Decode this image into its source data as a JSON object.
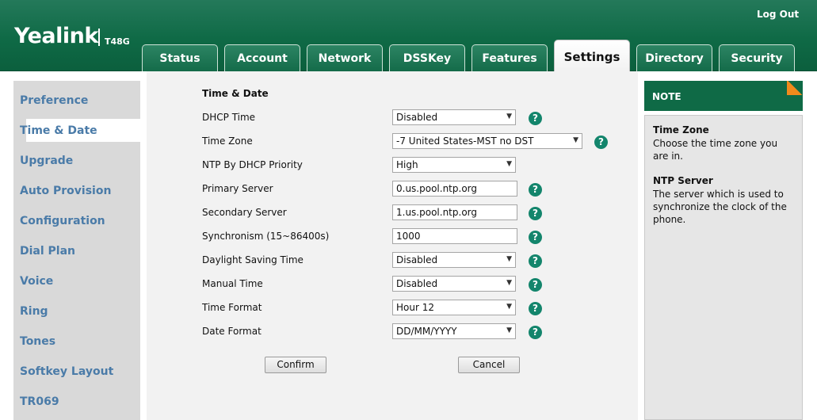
{
  "header": {
    "brand": "Yealink",
    "model": "T48G",
    "logout": "Log Out",
    "tabs": [
      {
        "label": "Status"
      },
      {
        "label": "Account"
      },
      {
        "label": "Network"
      },
      {
        "label": "DSSKey"
      },
      {
        "label": "Features"
      },
      {
        "label": "Settings",
        "active": true
      },
      {
        "label": "Directory"
      },
      {
        "label": "Security"
      }
    ]
  },
  "sidebar": {
    "items": [
      {
        "label": "Preference"
      },
      {
        "label": "Time & Date",
        "active": true
      },
      {
        "label": "Upgrade"
      },
      {
        "label": "Auto Provision"
      },
      {
        "label": "Configuration"
      },
      {
        "label": "Dial Plan"
      },
      {
        "label": "Voice"
      },
      {
        "label": "Ring"
      },
      {
        "label": "Tones"
      },
      {
        "label": "Softkey Layout"
      },
      {
        "label": "TR069"
      }
    ]
  },
  "form": {
    "title": "Time & Date",
    "rows": [
      {
        "label": "DHCP Time",
        "type": "select",
        "value": "Disabled"
      },
      {
        "label": "Time Zone",
        "type": "select",
        "value": "-7 United States-MST no DST"
      },
      {
        "label": "NTP By DHCP Priority",
        "type": "select",
        "value": "High"
      },
      {
        "label": "Primary Server",
        "type": "input",
        "value": "0.us.pool.ntp.org"
      },
      {
        "label": "Secondary Server",
        "type": "input",
        "value": "1.us.pool.ntp.org"
      },
      {
        "label": "Synchronism (15~86400s)",
        "type": "input",
        "value": "1000"
      },
      {
        "label": "Daylight Saving Time",
        "type": "select",
        "value": "Disabled"
      },
      {
        "label": "Manual Time",
        "type": "select",
        "value": "Disabled"
      },
      {
        "label": "Time Format",
        "type": "select",
        "value": "Hour 12"
      },
      {
        "label": "Date Format",
        "type": "select",
        "value": "DD/MM/YYYY"
      }
    ],
    "help_glyph": "?",
    "confirm": "Confirm",
    "cancel": "Cancel"
  },
  "note": {
    "title": "NOTE",
    "sections": [
      {
        "heading": "Time Zone",
        "text": "Choose the time zone you are in."
      },
      {
        "heading": "NTP Server",
        "text": "The server which is used to synchronize the clock of the phone."
      }
    ]
  },
  "icons": {
    "select_arrow": "chevron-down-icon",
    "help": "help-icon"
  },
  "colors": {
    "header_green": "#0f6a46",
    "sidebar_link": "#4a7ba8",
    "help_teal": "#13856c",
    "note_corner": "#f08a1c"
  }
}
